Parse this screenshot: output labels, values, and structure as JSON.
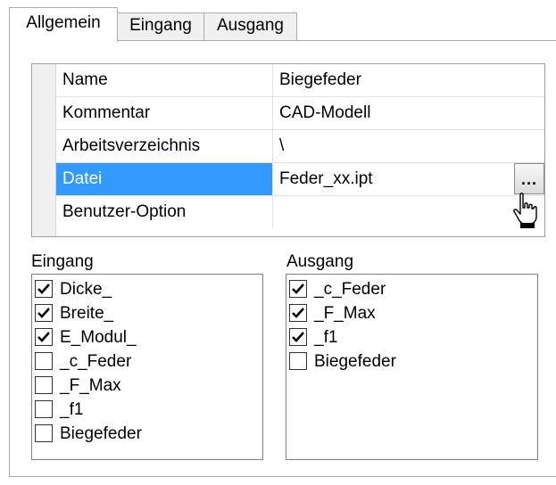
{
  "tabs": [
    {
      "label": "Allgemein",
      "active": true
    },
    {
      "label": "Eingang",
      "active": false
    },
    {
      "label": "Ausgang",
      "active": false
    }
  ],
  "properties": [
    {
      "name": "Name",
      "value": "Biegefeder"
    },
    {
      "name": "Kommentar",
      "value": "CAD-Modell"
    },
    {
      "name": "Arbeitsverzeichnis",
      "value": "\\"
    },
    {
      "name": "Datei",
      "value": "Feder_xx.ipt",
      "selected": true,
      "button_label": "..."
    },
    {
      "name": "Benutzer-Option",
      "value": ""
    }
  ],
  "eingang": {
    "label": "Eingang",
    "items": [
      {
        "label": "Dicke_",
        "checked": true
      },
      {
        "label": "Breite_",
        "checked": true
      },
      {
        "label": "E_Modul_",
        "checked": true
      },
      {
        "label": "_c_Feder",
        "checked": false
      },
      {
        "label": "_F_Max",
        "checked": false
      },
      {
        "label": "_f1",
        "checked": false
      },
      {
        "label": "Biegefeder",
        "checked": false
      }
    ]
  },
  "ausgang": {
    "label": "Ausgang",
    "items": [
      {
        "label": "_c_Feder",
        "checked": true
      },
      {
        "label": "_F_Max",
        "checked": true
      },
      {
        "label": "_f1",
        "checked": true
      },
      {
        "label": "Biegefeder",
        "checked": false
      }
    ]
  },
  "colors": {
    "selection": "#3399ff",
    "border": "#adadad"
  },
  "cursor_icon": "hand-pointer-icon"
}
